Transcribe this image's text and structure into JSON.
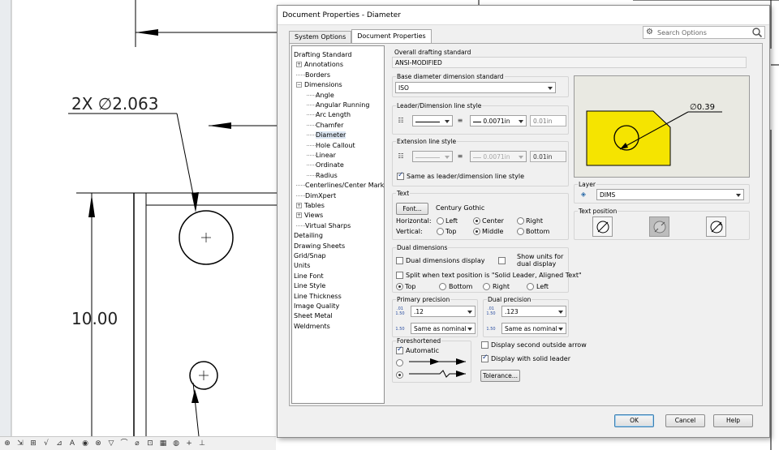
{
  "cad": {
    "dim_hole": "2X ∅2.063",
    "dim_height": "10.00"
  },
  "taskbar": {
    "icons": [
      "smart-dimension-icon",
      "horizontal-dimension-icon",
      "vertical-dimension-icon",
      "ordinate-dimension-icon",
      "chamfer-dimension-icon",
      "note-icon",
      "balloon-icon",
      "auto-balloon-icon",
      "surface-finish-icon",
      "weld-symbol-icon",
      "hole-callout-icon",
      "geometric-tolerance-icon",
      "datum-feature-icon",
      "datum-target-icon",
      "center-mark-icon",
      "centerline-icon"
    ],
    "glyphs": [
      "⊕",
      "⇲",
      "⊞",
      "√",
      "⊿",
      "A",
      "◉",
      "⊗",
      "▽",
      "⌒",
      "⌀",
      "⊡",
      "▦",
      "◍",
      "+",
      "⊥"
    ]
  },
  "dialog": {
    "title": "Document Properties - Diameter",
    "tabs": [
      "System Options",
      "Document Properties"
    ],
    "search_placeholder": "Search Options",
    "tree": [
      {
        "label": "Drafting Standard",
        "level": 0
      },
      {
        "label": "Annotations",
        "level": 1,
        "exp": "+"
      },
      {
        "label": "Borders",
        "level": 1
      },
      {
        "label": "Dimensions",
        "level": 1,
        "exp": "−"
      },
      {
        "label": "Angle",
        "level": 2
      },
      {
        "label": "Angular Running",
        "level": 2
      },
      {
        "label": "Arc Length",
        "level": 2
      },
      {
        "label": "Chamfer",
        "level": 2
      },
      {
        "label": "Diameter",
        "level": 2,
        "selected": true
      },
      {
        "label": "Hole Callout",
        "level": 2
      },
      {
        "label": "Linear",
        "level": 2
      },
      {
        "label": "Ordinate",
        "level": 2
      },
      {
        "label": "Radius",
        "level": 2
      },
      {
        "label": "Centerlines/Center Marks",
        "level": 1
      },
      {
        "label": "DimXpert",
        "level": 1
      },
      {
        "label": "Tables",
        "level": 1,
        "exp": "+"
      },
      {
        "label": "Views",
        "level": 1,
        "exp": "+"
      },
      {
        "label": "Virtual Sharps",
        "level": 1
      },
      {
        "label": "Detailing",
        "level": 0
      },
      {
        "label": "Drawing Sheets",
        "level": 0
      },
      {
        "label": "Grid/Snap",
        "level": 0
      },
      {
        "label": "Units",
        "level": 0
      },
      {
        "label": "Line Font",
        "level": 0
      },
      {
        "label": "Line Style",
        "level": 0
      },
      {
        "label": "Line Thickness",
        "level": 0
      },
      {
        "label": "Image Quality",
        "level": 0
      },
      {
        "label": "Sheet Metal",
        "level": 0
      },
      {
        "label": "Weldments",
        "level": 0
      }
    ],
    "overall": {
      "label": "Overall drafting standard",
      "value": "ANSI-MODIFIED"
    },
    "base": {
      "label": "Base diameter dimension standard",
      "value": "ISO"
    },
    "leader": {
      "label": "Leader/Dimension line style",
      "thickness": "0.0071in",
      "custom": "0.01in"
    },
    "extension": {
      "label": "Extension line style",
      "thickness": "0.0071in",
      "custom": "0.01in",
      "same_label": "Same as leader/dimension line style"
    },
    "text": {
      "label": "Text",
      "font_button": "Font...",
      "font_name": "Century Gothic",
      "horizontal_label": "Horizontal:",
      "vertical_label": "Vertical:",
      "h_options": [
        "Left",
        "Center",
        "Right"
      ],
      "v_options": [
        "Top",
        "Middle",
        "Bottom"
      ]
    },
    "dual": {
      "label": "Dual dimensions",
      "display": "Dual dimensions display",
      "show_units": "Show units for dual display",
      "split": "Split when text position is \"Solid Leader, Aligned Text\"",
      "positions": [
        "Top",
        "Bottom",
        "Right",
        "Left"
      ]
    },
    "primary_precision": {
      "label": "Primary precision",
      "value": ".12",
      "tolerance": "Same as nominal",
      "icon1a": ".01",
      "icon1b": "1.50",
      "icon2": "1.50"
    },
    "dual_precision": {
      "label": "Dual precision",
      "value": ".123",
      "tolerance": "Same as nominal",
      "icon1a": ".01",
      "icon1b": "1.50",
      "icon2": "1.50"
    },
    "foreshortened": {
      "label": "Foreshortened",
      "automatic": "Automatic"
    },
    "display_second_arrow": "Display second outside arrow",
    "display_solid_leader": "Display with solid leader",
    "tolerance_button": "Tolerance...",
    "preview_dim": "∅0.39",
    "layer": {
      "label": "Layer",
      "value": "DIMS"
    },
    "text_position": {
      "label": "Text position"
    },
    "buttons": {
      "ok": "OK",
      "cancel": "Cancel",
      "help": "Help"
    }
  },
  "colors": {
    "preview_part": "#f5e400",
    "preview_bg": "#e9e9e2",
    "ok_border": "#3c7fb1"
  }
}
